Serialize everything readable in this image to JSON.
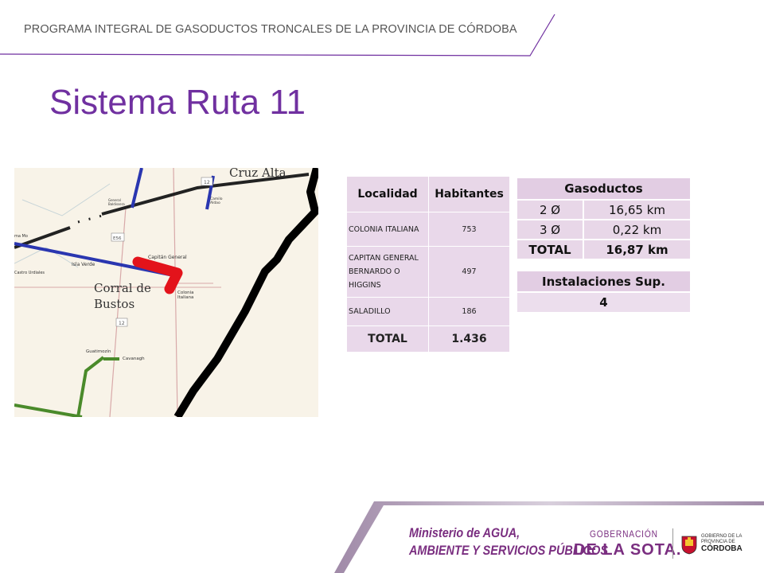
{
  "header": {
    "program": "PROGRAMA INTEGRAL DE GASODUCTOS TRONCALES DE LA PROVINCIA DE CÓRDOBA"
  },
  "title": "Sistema Ruta 11",
  "map": {
    "labels": {
      "cruz_alta": "Cruz Alta",
      "corral": "Corral de",
      "bustos": "Bustos",
      "capitan": "Capitán General",
      "colonia1": "Colonia",
      "colonia2": "Italiana",
      "isla": "Isla Verde",
      "castro": "Castro Urdiales",
      "guatimozin": "Guatimozín",
      "cavanagh": "Cavanagh",
      "general1": "General",
      "general2": "Baldissera",
      "camilo1": "Camilo",
      "camilo2": "Aldao",
      "route12a": "12",
      "route12b": "12",
      "e56": "E56",
      "ma": "ma Mo"
    }
  },
  "population_table": {
    "headers": [
      "Localidad",
      "Habitantes"
    ],
    "rows": [
      {
        "name": "COLONIA ITALIANA",
        "value": "753"
      },
      {
        "name": "CAPITAN GENERAL BERNARDO O HIGGINS",
        "value": "497"
      },
      {
        "name": "SALADILLO",
        "value": "186"
      }
    ],
    "total_label": "TOTAL",
    "total_value": "1.436"
  },
  "gas_table": {
    "header": "Gasoductos",
    "rows": [
      {
        "diameter": "2 Ø",
        "length": "16,65 km"
      },
      {
        "diameter": "3 Ø",
        "length": "0,22 km"
      }
    ],
    "total_label": "TOTAL",
    "total_value": "16,87 km"
  },
  "installations_table": {
    "header": "Instalaciones  Sup.",
    "value": "4"
  },
  "footer": {
    "ministry_line1": "Ministerio de AGUA,",
    "ministry_line2": "AMBIENTE Y SERVICIOS PÚBLICOS",
    "gob_line1": "GOBERNACIÓN",
    "gob_line2": "DE LA SOTA.",
    "prov_line1": "GOBIERNO DE LA",
    "prov_line2": "PROVINCIA DE",
    "prov_line3": "CÓRDOBA"
  },
  "colors": {
    "accent": "#7030a0",
    "table_fill": "#e8d7e8",
    "footer_purple": "#7a2e80"
  }
}
